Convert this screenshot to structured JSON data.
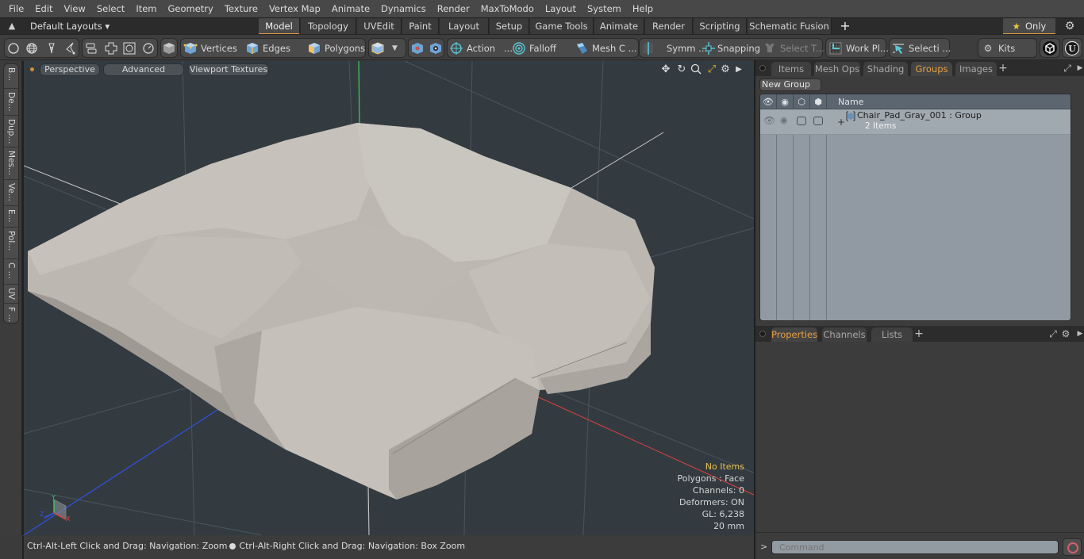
{
  "menu": [
    "File",
    "Edit",
    "View",
    "Select",
    "Item",
    "Geometry",
    "Texture",
    "Vertex Map",
    "Animate",
    "Dynamics",
    "Render",
    "MaxToModo",
    "Layout",
    "System",
    "Help"
  ],
  "layoutbar": {
    "layouts_label": "Default Layouts ▾",
    "tabs": [
      "Model",
      "Topology",
      "UVEdit",
      "Paint",
      "Layout",
      "Setup",
      "Game Tools",
      "Animate",
      "Render",
      "Scripting",
      "Schematic Fusion"
    ],
    "active_tab": "Model",
    "add_label": "+",
    "only_label": "Only"
  },
  "toolbar": {
    "vertices": "Vertices",
    "edges": "Edges",
    "polygons": "Polygons",
    "action": "Action",
    "action_more": "...",
    "falloff": "Falloff",
    "mesh": "Mesh C ...",
    "symm": "Symm ...",
    "snapping": "Snapping",
    "select_t": "Select T...",
    "work_plane": "Work Pl...",
    "selecti": "Selecti ...",
    "kits": "Kits"
  },
  "left_tabs": [
    "B...",
    "De...",
    "Dup...",
    "Mes...",
    "Ve...",
    "E...",
    "Pol...",
    "C ...",
    "UV",
    "F ..."
  ],
  "viewport": {
    "view_mode": "Perspective",
    "shading": "Advanced",
    "textures": "Viewport Textures",
    "info": {
      "items": "No Items",
      "polygons": "Polygons : Face",
      "channels": "Channels: 0",
      "deformers": "Deformers: ON",
      "gl": "GL: 6,238",
      "scale": "20 mm"
    },
    "axis_labels": {
      "x": "X",
      "y": "Y",
      "z": "Z"
    }
  },
  "status": {
    "left": "Ctrl-Alt-Left Click and Drag: Navigation: Zoom",
    "right": "Ctrl-Alt-Right Click and Drag: Navigation: Box Zoom"
  },
  "top_panel": {
    "tabs": [
      "Items",
      "Mesh Ops",
      "Shading",
      "Groups",
      "Images"
    ],
    "active_tab": "Groups",
    "new_group": "New Group",
    "name_header": "Name",
    "groups": [
      {
        "name": "Chair_Pad_Gray_001 : Group",
        "count": "2 Items",
        "expand": "+"
      }
    ]
  },
  "bottom_panel": {
    "tabs": [
      "Properties",
      "Channels",
      "Lists"
    ],
    "active_tab": "Properties"
  },
  "command": {
    "prompt": ">",
    "placeholder": "Command"
  },
  "colors": {
    "accent": "#e09a3a",
    "active_tab_text": "#e8a040",
    "info_highlight": "#e8c050",
    "viewport_bg": "#333b40",
    "list_bg": "#919aa2"
  }
}
